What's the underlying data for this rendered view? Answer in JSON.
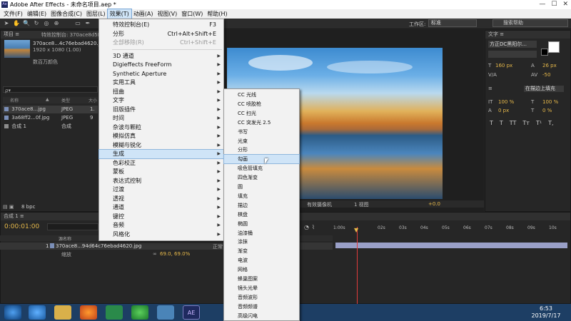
{
  "window": {
    "title": "Adobe After Effects - 未命名项目.aep *",
    "controls": [
      "—",
      "☐",
      "✕"
    ]
  },
  "menubar": [
    "文件(F)",
    "编辑(E)",
    "图像合成(C)",
    "图层(L)",
    "效果(T)",
    "动画(A)",
    "视图(V)",
    "窗口(W)",
    "帮助(H)"
  ],
  "toolbar": {
    "workspace_label": "工作区:",
    "workspace_value": "标准",
    "search_placeholder": "搜索帮助"
  },
  "project": {
    "tab": "项目 ≡",
    "effects_tab": "特效控制台: 370ace8d5I...",
    "file_name": "370ace8...4c76ebad4620.jpg ▾",
    "file_dims": "1920 x 1080 (1.00)",
    "file_colors": "数百万颜色",
    "search_placeholder": "ρ▾",
    "headers": [
      "名称",
      "▲",
      "类型",
      "大小"
    ],
    "rows": [
      {
        "name": "370ace8...jpg",
        "type": "JPEG",
        "size": "1.",
        "color": "#7b8fb8"
      },
      {
        "name": "3a68ff2...0f.jpg",
        "type": "JPEG",
        "size": "9",
        "color": "#7b8fb8"
      },
      {
        "name": "合成 1",
        "type": "合成",
        "size": "",
        "color": "#8c8c8c"
      }
    ],
    "bpc": "8 bpc"
  },
  "viewer": {
    "camera": "有效摄像机",
    "views": "1 视图",
    "offset": "+0.0"
  },
  "character": {
    "tab": "文字 ≡",
    "font": "方正DC黑阳尔...",
    "size": "160 px",
    "leading": "26 px",
    "tracking": "-50",
    "scale_v": "100 %",
    "scale_h": "100 %",
    "baseline": "0 px",
    "tsume": "0 %",
    "stroke": "在描边上填充",
    "glyphs": [
      "T",
      "T",
      "TT",
      "Tт",
      "T¹",
      "T,"
    ]
  },
  "timeline": {
    "tab": "合成 1 ≡",
    "timecode": "0:00:01:00",
    "layer_name": "370ace8...94d64c76ebad4620.jpg",
    "layer_index": "1",
    "layer_prop": "缩放",
    "layer_value": "69.0, 69.0%",
    "layer_mode": "正常",
    "ruler": [
      "1:00s",
      "02s",
      "03s",
      "04s",
      "05s",
      "06s",
      "07s",
      "08s",
      "09s",
      "10s"
    ]
  },
  "effects_menu": {
    "items": [
      {
        "label": "特效控制台(E)",
        "shortcut": "F3",
        "gray": false,
        "submenu": false
      },
      {
        "label": "分形",
        "shortcut": "Ctrl+Alt+Shift+E",
        "gray": false,
        "submenu": false
      },
      {
        "label": "全部移除(R)",
        "shortcut": "Ctrl+Shift+E",
        "gray": true,
        "submenu": false
      },
      {
        "label": "3D 通道",
        "shortcut": "",
        "gray": false,
        "submenu": true
      },
      {
        "label": "Digieffects FreeForm",
        "shortcut": "",
        "gray": false,
        "submenu": true
      },
      {
        "label": "Synthetic Aperture",
        "shortcut": "",
        "gray": false,
        "submenu": true
      },
      {
        "label": "实用工具",
        "shortcut": "",
        "gray": false,
        "submenu": true
      },
      {
        "label": "扭曲",
        "shortcut": "",
        "gray": false,
        "submenu": true
      },
      {
        "label": "文字",
        "shortcut": "",
        "gray": false,
        "submenu": true
      },
      {
        "label": "旧版插件",
        "shortcut": "",
        "gray": false,
        "submenu": true
      },
      {
        "label": "时间",
        "shortcut": "",
        "gray": false,
        "submenu": true
      },
      {
        "label": "杂波与颗粒",
        "shortcut": "",
        "gray": false,
        "submenu": true
      },
      {
        "label": "模拟仿真",
        "shortcut": "",
        "gray": false,
        "submenu": true
      },
      {
        "label": "模糊与锐化",
        "shortcut": "",
        "gray": false,
        "submenu": true
      },
      {
        "label": "生成",
        "shortcut": "",
        "gray": false,
        "submenu": true,
        "highlighted": true
      },
      {
        "label": "色彩校正",
        "shortcut": "",
        "gray": false,
        "submenu": true
      },
      {
        "label": "蒙板",
        "shortcut": "",
        "gray": false,
        "submenu": true
      },
      {
        "label": "表达式控制",
        "shortcut": "",
        "gray": false,
        "submenu": true
      },
      {
        "label": "过渡",
        "shortcut": "",
        "gray": false,
        "submenu": true
      },
      {
        "label": "透视",
        "shortcut": "",
        "gray": false,
        "submenu": true
      },
      {
        "label": "通道",
        "shortcut": "",
        "gray": false,
        "submenu": true
      },
      {
        "label": "键控",
        "shortcut": "",
        "gray": false,
        "submenu": true
      },
      {
        "label": "音频",
        "shortcut": "",
        "gray": false,
        "submenu": true
      },
      {
        "label": "风格化",
        "shortcut": "",
        "gray": false,
        "submenu": true
      }
    ]
  },
  "generate_menu": {
    "items": [
      "CC 光线",
      "CC 喷胶枪",
      "CC 扫光",
      "CC 突发光 2.5",
      "书写",
      "光束",
      "分形",
      "勾画",
      "吸色管填充",
      "四色渐变",
      "圆",
      "填充",
      "描边",
      "棋盘",
      "椭圆",
      "油漆桶",
      "涂抹",
      "渐变",
      "电波",
      "网格",
      "蜂巢图案",
      "镜头光晕",
      "音频波形",
      "音频频谱",
      "高级闪电"
    ],
    "highlighted": "勾画"
  },
  "taskbar": {
    "time": "6:53",
    "date": "2019/7/17",
    "ae_label": "AE"
  }
}
